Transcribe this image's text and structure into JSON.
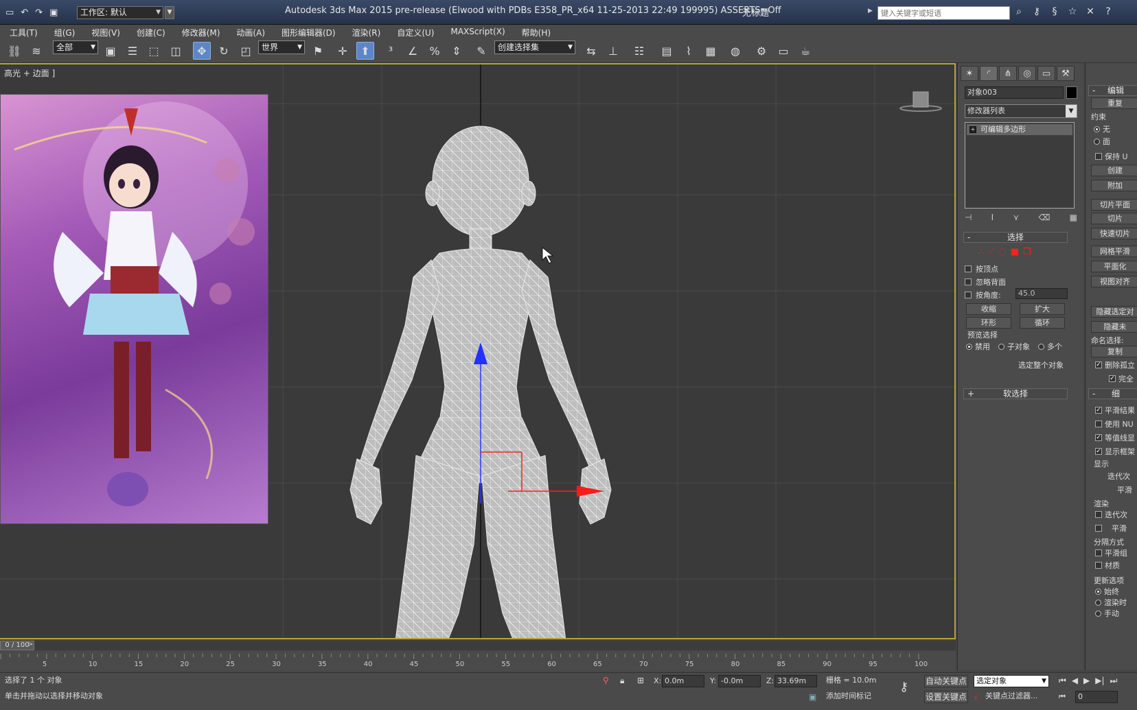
{
  "titlebar": {
    "workspace": "工作区: 默认",
    "app_title": "Autodesk 3ds Max  2015 pre-release (Elwood with PDBs E358_PR_x64 11-25-2013 22:49 199995) ASSERTS=Off",
    "doc_title": "无标题",
    "search_placeholder": "键入关键字或短语"
  },
  "menu": [
    "工具(T)",
    "组(G)",
    "视图(V)",
    "创建(C)",
    "修改器(M)",
    "动画(A)",
    "图形编辑器(D)",
    "渲染(R)",
    "自定义(U)",
    "MAXScript(X)",
    "帮助(H)"
  ],
  "toolbar": {
    "filter": "全部",
    "ref_coord": "世界",
    "named_sel": "创建选择集"
  },
  "viewport": {
    "label": "高光 + 边面 ]"
  },
  "command_panel": {
    "object_name": "对象003",
    "modifier_list": "修改器列表",
    "stack_item": "可编辑多边形",
    "selection": {
      "title": "选择",
      "by_vertex": "按顶点",
      "ignore_backface": "忽略背面",
      "by_angle": "按角度:",
      "angle_value": "45.0",
      "shrink": "收缩",
      "grow": "扩大",
      "ring": "环形",
      "loop": "循环",
      "preview_title": "预览选择",
      "preview_off": "禁用",
      "preview_sub": "子对象",
      "preview_multi": "多个",
      "select_whole": "选定整个对象"
    },
    "soft_selection": "软选择"
  },
  "right_panel": {
    "edit_geom": "编辑",
    "repeat": "重复",
    "constraints": "约束",
    "none": "无",
    "face": "面",
    "preserve_uv": "保持 U",
    "create": "创建",
    "attach": "附加",
    "slice_plane": "切片平面",
    "slice": "切片",
    "quickslice": "快速切片",
    "meshsmooth": "网格平滑",
    "planarize": "平面化",
    "view_align": "视图对齐",
    "hide_sel": "隐藏选定对",
    "hide_unsel": "隐藏未",
    "named_sel": "命名选择:",
    "copy": "复制",
    "delete_iso": "删除孤立",
    "full": "完全",
    "subdiv": "细",
    "smooth_result": "平滑结果",
    "use_nurms": "使用 NU",
    "isoline": "等值线显",
    "show_cage": "显示框架",
    "display": "显示",
    "iterations": "迭代次",
    "smoothness": "平滑",
    "render": "渲染",
    "iter2": "迭代次",
    "smooth2": "平滑",
    "sep_by": "分隔方式",
    "smooth_groups": "平滑组",
    "materials": "材质",
    "update": "更新选项",
    "always": "始终",
    "when_render": "渲染时",
    "manual": "手动"
  },
  "timeline": {
    "frame_display": "0 / 100",
    "ticks": [
      "5",
      "10",
      "15",
      "20",
      "25",
      "30",
      "35",
      "40",
      "45",
      "50",
      "55",
      "60",
      "65",
      "70",
      "75",
      "80",
      "85",
      "90",
      "95",
      "100"
    ]
  },
  "status": {
    "selected": "选择了 1 个 对象",
    "prompt": "单击并拖动以选择并移动对象",
    "x_label": "X:",
    "x": "0.0m",
    "y_label": "Y:",
    "y": "-0.0m",
    "z_label": "Z:",
    "z": "33.69m",
    "grid": "栅格 = 10.0m",
    "add_time_tag": "添加时间标记",
    "auto_key": "自动关键点",
    "set_key": "设置关键点",
    "selected_obj": "选定对象",
    "key_filters": "关键点过滤器...",
    "frame": "0"
  }
}
